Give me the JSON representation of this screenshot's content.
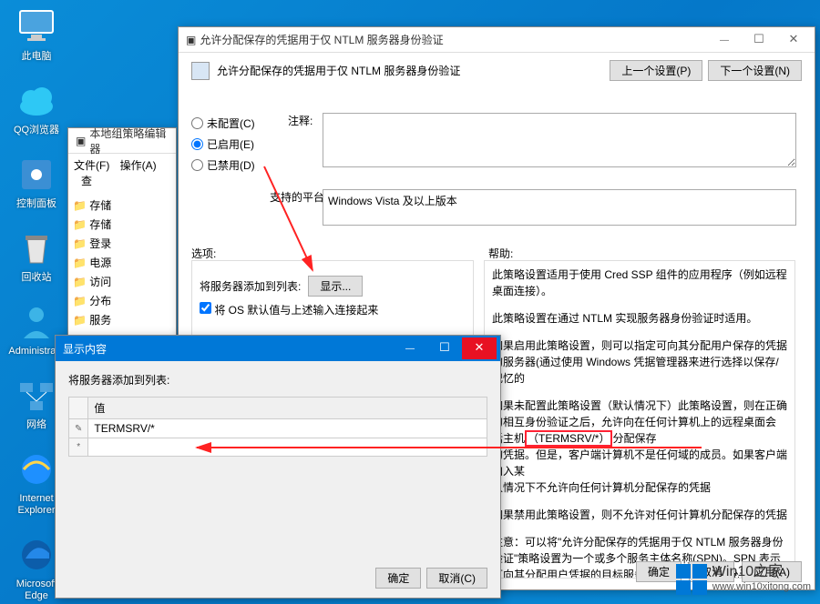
{
  "desktop_icons": {
    "this_pc": "此电脑",
    "qq_browser": "QQ浏览器",
    "control_panel": "控制面板",
    "recycle_bin": "回收站",
    "administrator": "Administra...",
    "network": "网络",
    "ie": "Internet Explorer",
    "edge": "Microsoft Edge"
  },
  "gpedit": {
    "title": "本地组策略编辑器",
    "menu": {
      "file": "文件(F)",
      "action": "操作(A)",
      "view": "查"
    },
    "tree": [
      "存储",
      "存储",
      "登录",
      "电源",
      "访问",
      "分布",
      "服务"
    ]
  },
  "policy": {
    "title": "允许分配保存的凭据用于仅 NTLM 服务器身份验证",
    "subtitle": "允许分配保存的凭据用于仅 NTLM 服务器身份验证",
    "prev_btn": "上一个设置(P)",
    "next_btn": "下一个设置(N)",
    "radios": {
      "not_configured": "未配置(C)",
      "enabled": "已启用(E)",
      "disabled": "已禁用(D)"
    },
    "comment_label": "注释:",
    "platform_label": "支持的平台:",
    "platform_value": "Windows Vista 及以上版本",
    "options_label": "选项:",
    "help_label": "帮助:",
    "options": {
      "add_servers_label": "将服务器添加到列表:",
      "show_btn": "显示...",
      "concat_checkbox": "将 OS 默认值与上述输入连接起来"
    },
    "help": {
      "p1": "此策略设置适用于使用 Cred SSP 组件的应用程序（例如远程桌面连接）。",
      "p2": "此策略设置在通过 NTLM 实现服务器身份验证时适用。",
      "p3_a": "如果启用此策略设置，则可以指定可向其分配用户保存的凭据的服务器(",
      "p3_b": "通过使用 Windows 凭据管理器来进行选择以保存/记忆的",
      "p4_a": "如果未配置此策略设置（默认情况下）此策略设置，则在正确的相互身份验证之后，",
      "p4_b": "允许向在任何计算机上的远程桌面会话主机",
      "p4_term": "（TERMSRV/*）",
      "p4_c": "分配保存",
      "p4_d": "的凭据。但是，客户端计算机不是任何域的成员。如果客户端加入某",
      "p4_e": "认情况下不允许向任何计算机分配保存的凭据",
      "p5": "如果禁用此策略设置，则不允许对任何计算机分配保存的凭据",
      "p6": "注意：可以将\"允许分配保存的凭据用于仅 NTLM 服务器身份验证\"策略设置为一个或多个服务主体名称(SPN)。SPN 表示可向其分配用户凭据的目标服务器。指定 SPN 时允许使用通配符。"
    },
    "footer": {
      "ok": "确定",
      "cancel": "取消",
      "apply": "应用(A)"
    }
  },
  "show_contents": {
    "title": "显示内容",
    "prompt": "将服务器添加到列表:",
    "col_value": "值",
    "rows": [
      "TERMSRV/*",
      ""
    ],
    "row_markers": [
      "✎",
      "*"
    ],
    "ok": "确定",
    "cancel": "取消(C)"
  },
  "watermark": {
    "name": "Win10之家",
    "url": "www.win10xitong.com"
  }
}
